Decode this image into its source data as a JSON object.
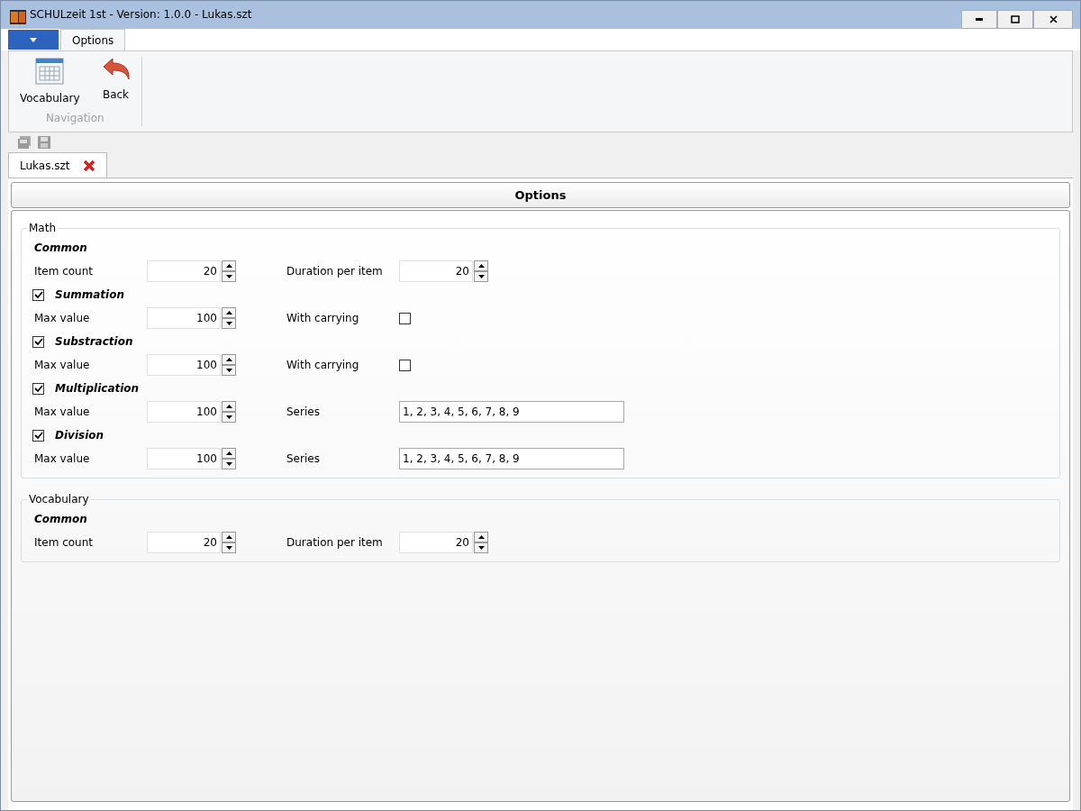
{
  "window": {
    "title": "SCHULzeit 1st - Version: 1.0.0 - Lukas.szt"
  },
  "ribbon": {
    "tabs": [
      {
        "label": "Options",
        "selected": true
      }
    ],
    "groups": [
      {
        "label": "Navigation",
        "buttons": [
          {
            "label": "Vocabulary",
            "kind": "table"
          },
          {
            "label": "Back",
            "kind": "back"
          }
        ]
      }
    ]
  },
  "document_tabs": [
    {
      "label": "Lukas.szt",
      "selected": true
    }
  ],
  "panel_title": "Options",
  "sections": [
    {
      "title": "Math",
      "blocks": [
        {
          "heading": "Common",
          "rows": [
            [
              {
                "kind": "spin",
                "label": "Item count",
                "value": "20"
              },
              {
                "kind": "spin",
                "label": "Duration per item",
                "value": "20"
              }
            ]
          ]
        },
        {
          "heading": "Summation",
          "checked": true,
          "rows": [
            [
              {
                "kind": "spin",
                "label": "Max value",
                "value": "100"
              },
              {
                "kind": "check",
                "label": "With carrying",
                "checked": false
              }
            ]
          ]
        },
        {
          "heading": "Substraction",
          "checked": true,
          "rows": [
            [
              {
                "kind": "spin",
                "label": "Max value",
                "value": "100"
              },
              {
                "kind": "check",
                "label": "With carrying",
                "checked": false
              }
            ]
          ]
        },
        {
          "heading": "Multiplication",
          "checked": true,
          "rows": [
            [
              {
                "kind": "spin",
                "label": "Max value",
                "value": "100"
              },
              {
                "kind": "text",
                "label": "Series",
                "value": "1, 2, 3, 4, 5, 6, 7, 8, 9"
              }
            ]
          ]
        },
        {
          "heading": "Division",
          "checked": true,
          "rows": [
            [
              {
                "kind": "spin",
                "label": "Max value",
                "value": "100"
              },
              {
                "kind": "text",
                "label": "Series",
                "value": "1, 2, 3, 4, 5, 6, 7, 8, 9"
              }
            ]
          ]
        }
      ]
    },
    {
      "title": "Vocabulary",
      "blocks": [
        {
          "heading": "Common",
          "rows": [
            [
              {
                "kind": "spin",
                "label": "Item count",
                "value": "20"
              },
              {
                "kind": "spin",
                "label": "Duration per item",
                "value": "20"
              }
            ]
          ]
        }
      ]
    }
  ]
}
